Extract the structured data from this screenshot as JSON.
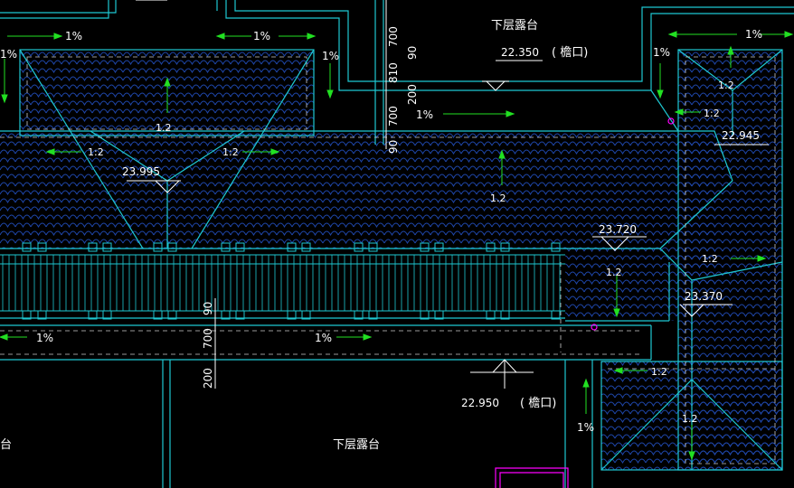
{
  "colors": {
    "background": "#000000",
    "outline": "#1ec8d2",
    "tile": "#1e46aa",
    "text": "#ffffff",
    "arrow": "#22e022",
    "marker": "#ff00ff"
  },
  "labels": {
    "terrace_top": "下层露台",
    "terrace_bottom": "下层露台",
    "terrace_left_cut": "台",
    "eave_top_elev": "22.350",
    "eave_top_note": "( 檐口)",
    "eave_bottom_elev": "22.950",
    "eave_bottom_note": "( 檐口)",
    "ridge_left_elev": "23.995",
    "ridge_mid_elev": "23.720",
    "ridge_right_elev": "23.370",
    "top_right_elev": "22.945",
    "slope_1pct": "1%",
    "slope_12": "1:2",
    "slope_1p2": "1.2"
  },
  "dimensions": {
    "top_700a": "700",
    "top_90a": "90",
    "top_810": "810",
    "top_200": "200",
    "top_700b": "700",
    "top_90b": "90",
    "bottom_90": "90",
    "bottom_700": "700",
    "bottom_200": "200"
  }
}
